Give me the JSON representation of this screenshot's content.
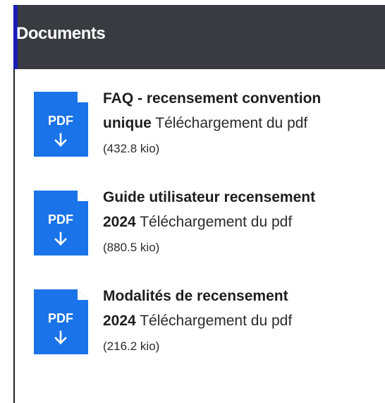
{
  "panel": {
    "title": "Documents"
  },
  "documents": [
    {
      "icon_label": "PDF",
      "title_line1": "FAQ - recensement convention",
      "title_line2": "unique",
      "action": "Téléchargement du pdf",
      "size": "(432.8 kio)"
    },
    {
      "icon_label": "PDF",
      "title_line1": "Guide utilisateur recensement",
      "title_line2": "2024",
      "action": "Téléchargement du pdf",
      "size": "(880.5 kio)"
    },
    {
      "icon_label": "PDF",
      "title_line1": "Modalités de recensement",
      "title_line2": "2024",
      "action": "Téléchargement du pdf",
      "size": "(216.2 kio)"
    }
  ],
  "colors": {
    "header_bg": "#3a3b40",
    "header_accent": "#1a1cb8",
    "pdf_icon_blue": "#1a73e8",
    "text": "#1e1e1e"
  },
  "icons": {
    "document": "pdf-download-icon",
    "arrow": "arrow-down-icon"
  }
}
